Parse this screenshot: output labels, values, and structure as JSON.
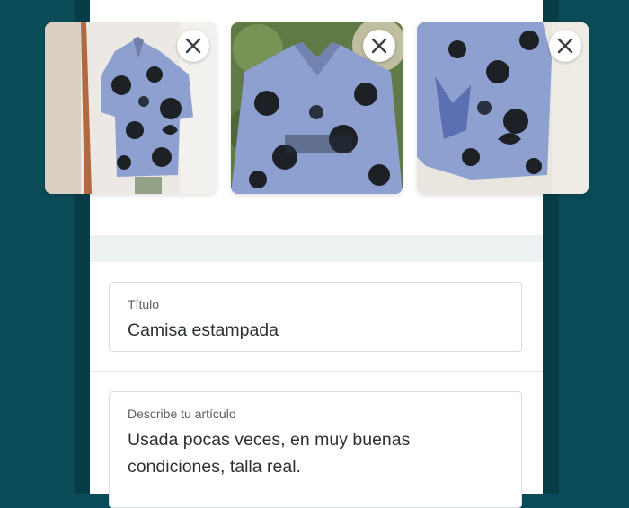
{
  "photos": [
    {
      "icon": "close-icon"
    },
    {
      "icon": "close-icon"
    },
    {
      "icon": "close-icon"
    }
  ],
  "form": {
    "title_field": {
      "label": "Título",
      "value": "Camisa estampada"
    },
    "description_field": {
      "label": "Describe tu artículo",
      "value": "Usada pocas veces, en muy buenas condiciones, talla real."
    }
  },
  "colors": {
    "background_teal": "#0b4a58",
    "shirt_blue": "#8da0cf",
    "print_dark": "#1d2126"
  }
}
